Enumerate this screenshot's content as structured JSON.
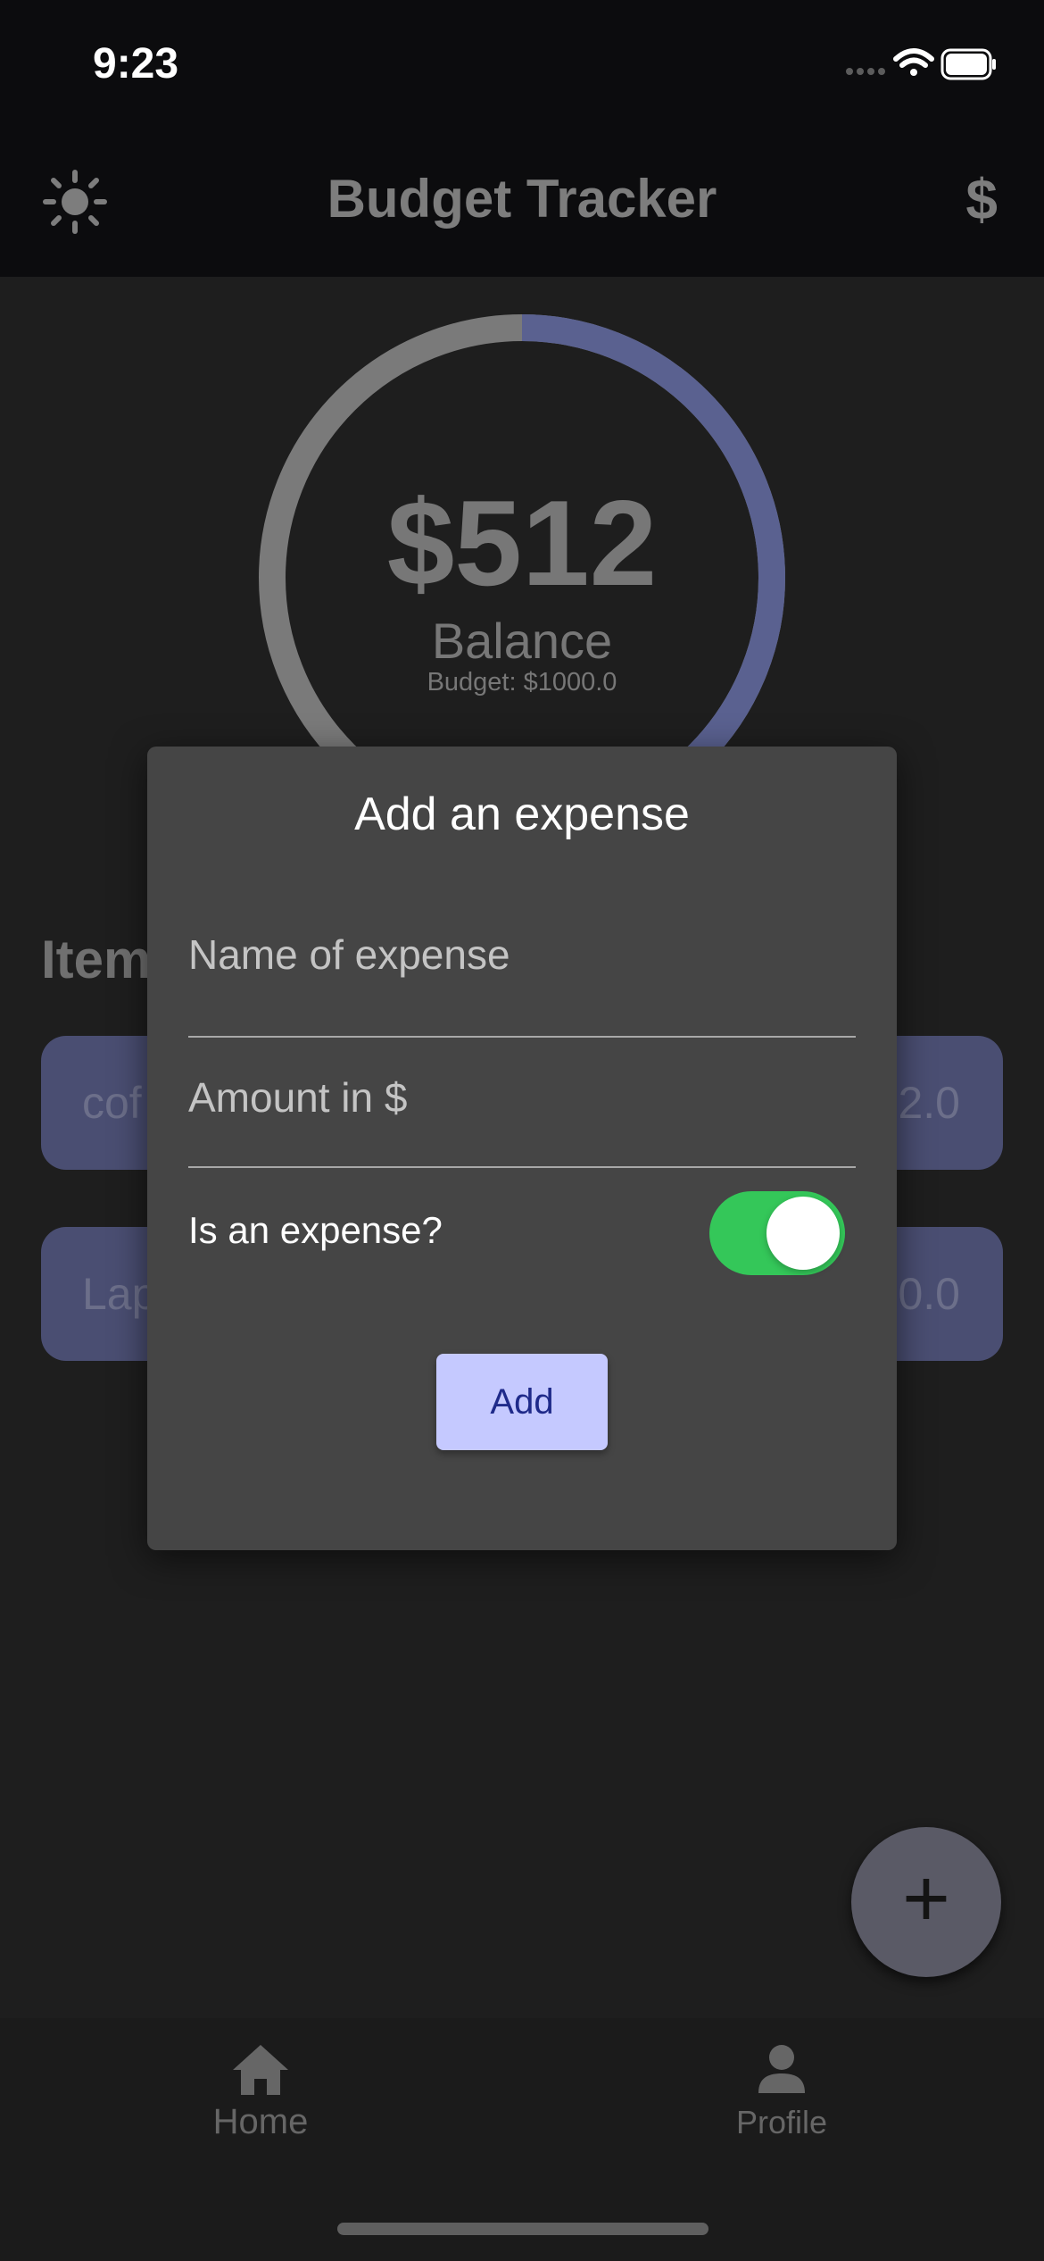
{
  "status_bar": {
    "time": "9:23",
    "icons": [
      "signal-icon",
      "wifi-icon",
      "battery-icon"
    ]
  },
  "app_bar": {
    "title": "Budget Tracker",
    "theme_icon": "sun-icon",
    "currency_label": "$"
  },
  "balance": {
    "amount": "$512",
    "label": "Balance",
    "budget": "Budget: $1000.0",
    "ring_fraction": 0.512,
    "ring_color": "#5a6190",
    "track_color": "#7a7a7a"
  },
  "items": {
    "heading": "Item",
    "list": [
      {
        "name": "cof",
        "value": "2.0"
      },
      {
        "name": "Lap",
        "value": "0.0"
      }
    ]
  },
  "dialog": {
    "title": "Add an expense",
    "name_placeholder": "Name of expense",
    "amount_placeholder": "Amount in $",
    "toggle_label": "Is an expense?",
    "toggle_on": true,
    "add_label": "Add"
  },
  "fab": {
    "label": "+",
    "icon": "plus-icon"
  },
  "bottom_nav": {
    "items": [
      {
        "label": "Home",
        "icon": "home-icon"
      },
      {
        "label": "Profile",
        "icon": "person-icon"
      }
    ]
  },
  "colors": {
    "accent": "#c5c9ff",
    "toggle_on": "#34c759",
    "card": "#4a4e72"
  }
}
